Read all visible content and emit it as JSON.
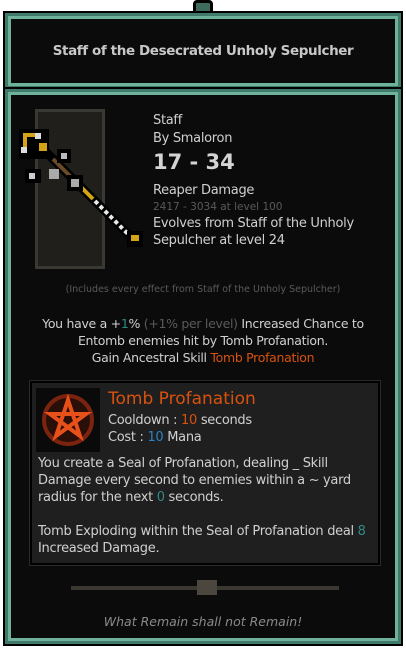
{
  "title": "Staff of the Desecrated Unholy Sepulcher",
  "item": {
    "type": "Staff",
    "author": "By Smaloron",
    "damage": "17 - 34",
    "damage_type": "Reaper Damage",
    "max_damage": "2417 - 3034 at level 100",
    "evolves": "Evolves from Staff of the Unholy Sepulcher at level 24",
    "includes": "(Includes every effect from Staff of the Unholy Sepulcher)"
  },
  "effect": {
    "p1": "You have a ",
    "bonus_sign": "+",
    "bonus_value": "1",
    "bonus_pct": "%",
    "per_level": " (+1% per level) ",
    "p2": "Increased Chance to Entomb enemies hit by Tomb Profanation.",
    "p3": "Gain Ancestral Skill ",
    "skill_link": "Tomb Profanation"
  },
  "skill": {
    "name": "Tomb Profanation",
    "cooldown_label": "Cooldown : ",
    "cooldown_value": "10",
    "cooldown_unit": " seconds",
    "cost_label": "Cost : ",
    "cost_value": "10",
    "cost_unit": " Mana",
    "desc1a": "You create a Seal of Profanation, dealing _ Skill Damage every second to enemies within a ~ yard radius for the next ",
    "desc1_value": "0",
    "desc1b": " seconds.",
    "desc2a": "Tomb Exploding within the Seal of Profanation deal ",
    "desc2_value": "8",
    "desc2b": " Increased Damage."
  },
  "flavor": "What Remain shall not Remain!",
  "colors": {
    "frame": "#6fb29a",
    "orange": "#d8520f",
    "teal": "#2f8a86",
    "blue": "#2c83c6"
  }
}
